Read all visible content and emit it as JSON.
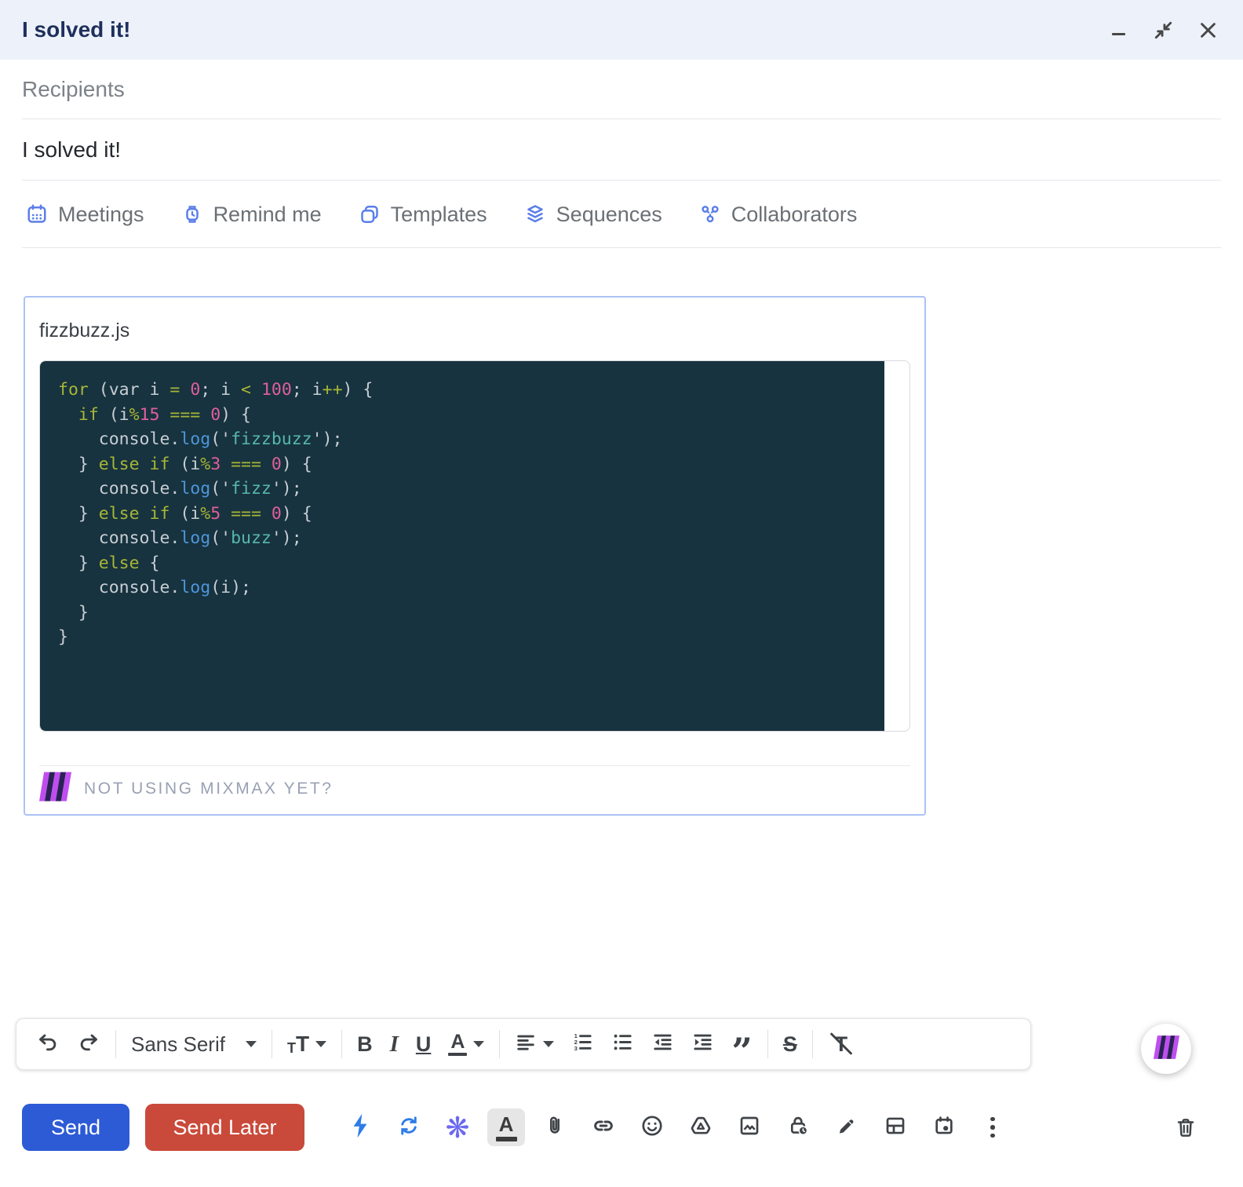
{
  "header": {
    "title": "I solved it!"
  },
  "window_controls": {
    "icons": [
      "minimize-icon",
      "exit-fullscreen-icon",
      "close-icon"
    ]
  },
  "fields": {
    "recipients_placeholder": "Recipients",
    "subject": "I solved it!"
  },
  "mixmax_toolbar": {
    "items": [
      {
        "label": "Meetings",
        "icon": "calendar-icon"
      },
      {
        "label": "Remind me",
        "icon": "watch-icon"
      },
      {
        "label": "Templates",
        "icon": "templates-icon"
      },
      {
        "label": "Sequences",
        "icon": "layers-icon"
      },
      {
        "label": "Collaborators",
        "icon": "people-icon"
      }
    ]
  },
  "snippet": {
    "filename": "fizzbuzz.js",
    "footer_prompt": "NOT USING MIXMAX YET?",
    "code_segments": [
      {
        "c": "k",
        "t": "for"
      },
      {
        "c": "p",
        "t": " (var i "
      },
      {
        "c": "k",
        "t": "="
      },
      {
        "c": "p",
        "t": " "
      },
      {
        "c": "n",
        "t": "0"
      },
      {
        "c": "p",
        "t": "; i "
      },
      {
        "c": "k",
        "t": "<"
      },
      {
        "c": "p",
        "t": " "
      },
      {
        "c": "n",
        "t": "100"
      },
      {
        "c": "p",
        "t": "; i"
      },
      {
        "c": "k",
        "t": "++"
      },
      {
        "c": "p",
        "t": ") {\n  "
      },
      {
        "c": "k",
        "t": "if"
      },
      {
        "c": "p",
        "t": " (i"
      },
      {
        "c": "k",
        "t": "%"
      },
      {
        "c": "n",
        "t": "15"
      },
      {
        "c": "p",
        "t": " "
      },
      {
        "c": "k",
        "t": "==="
      },
      {
        "c": "p",
        "t": " "
      },
      {
        "c": "n",
        "t": "0"
      },
      {
        "c": "p",
        "t": ") {\n    console."
      },
      {
        "c": "f",
        "t": "log"
      },
      {
        "c": "p",
        "t": "('"
      },
      {
        "c": "s",
        "t": "fizzbuzz"
      },
      {
        "c": "p",
        "t": "');\n  } "
      },
      {
        "c": "k",
        "t": "else"
      },
      {
        "c": "p",
        "t": " "
      },
      {
        "c": "k",
        "t": "if"
      },
      {
        "c": "p",
        "t": " (i"
      },
      {
        "c": "k",
        "t": "%"
      },
      {
        "c": "n",
        "t": "3"
      },
      {
        "c": "p",
        "t": " "
      },
      {
        "c": "k",
        "t": "==="
      },
      {
        "c": "p",
        "t": " "
      },
      {
        "c": "n",
        "t": "0"
      },
      {
        "c": "p",
        "t": ") {\n    console."
      },
      {
        "c": "f",
        "t": "log"
      },
      {
        "c": "p",
        "t": "('"
      },
      {
        "c": "s",
        "t": "fizz"
      },
      {
        "c": "p",
        "t": "');\n  } "
      },
      {
        "c": "k",
        "t": "else"
      },
      {
        "c": "p",
        "t": " "
      },
      {
        "c": "k",
        "t": "if"
      },
      {
        "c": "p",
        "t": " (i"
      },
      {
        "c": "k",
        "t": "%"
      },
      {
        "c": "n",
        "t": "5"
      },
      {
        "c": "p",
        "t": " "
      },
      {
        "c": "k",
        "t": "==="
      },
      {
        "c": "p",
        "t": " "
      },
      {
        "c": "n",
        "t": "0"
      },
      {
        "c": "p",
        "t": ") {\n    console."
      },
      {
        "c": "f",
        "t": "log"
      },
      {
        "c": "p",
        "t": "('"
      },
      {
        "c": "s",
        "t": "buzz"
      },
      {
        "c": "p",
        "t": "');\n  } "
      },
      {
        "c": "k",
        "t": "else"
      },
      {
        "c": "p",
        "t": " {\n    console."
      },
      {
        "c": "f",
        "t": "log"
      },
      {
        "c": "p",
        "t": "(i);\n  }\n}"
      }
    ]
  },
  "format_toolbar": {
    "font_name": "Sans Serif",
    "glyphs": {
      "size_small": "T",
      "size_large": "T",
      "bold": "B",
      "italic": "I",
      "underline": "U",
      "color": "A",
      "quote": "”",
      "strike": "S",
      "clear": "T"
    },
    "ol_digits": [
      "1",
      "2",
      "3"
    ],
    "icons": [
      "undo-icon",
      "redo-icon",
      "font-select",
      "text-size-icon",
      "bold-icon",
      "italic-icon",
      "underline-icon",
      "text-color-icon",
      "align-icon",
      "numbered-list-icon",
      "bulleted-list-icon",
      "indent-less-icon",
      "indent-more-icon",
      "quote-icon",
      "strikethrough-icon",
      "remove-formatting-icon"
    ]
  },
  "actions": {
    "send_label": "Send",
    "send_later_label": "Send Later",
    "glyphs": {
      "sparkle": "❋"
    },
    "icons": [
      "lightning-icon",
      "sync-icon",
      "sparkle-icon",
      "text-color-icon",
      "attach-icon",
      "link-icon",
      "emoji-icon",
      "drive-icon",
      "image-icon",
      "confidential-lock-icon",
      "signature-pen-icon",
      "layout-icon",
      "schedule-calendar-icon",
      "more-options-icon",
      "trash-icon"
    ]
  },
  "colors": {
    "titlebar_bg": "#edf2fa",
    "accent_blue": "#5b7ee9",
    "send_blue": "#2d5bd6",
    "send_later_red": "#c94a3a",
    "action_blue": "#2e7ce8",
    "sparkle_violet": "#6b68f2",
    "code_bg": "#17333f",
    "code_keyword": "#a7b636",
    "code_number": "#df5f9c",
    "code_string": "#57b8ad",
    "code_function": "#4e96da",
    "code_plain": "#c8ced4",
    "snippet_border": "#abc3f3",
    "mixmax_magenta": "#bf4df0",
    "mixmax_navy": "#2b2156"
  }
}
